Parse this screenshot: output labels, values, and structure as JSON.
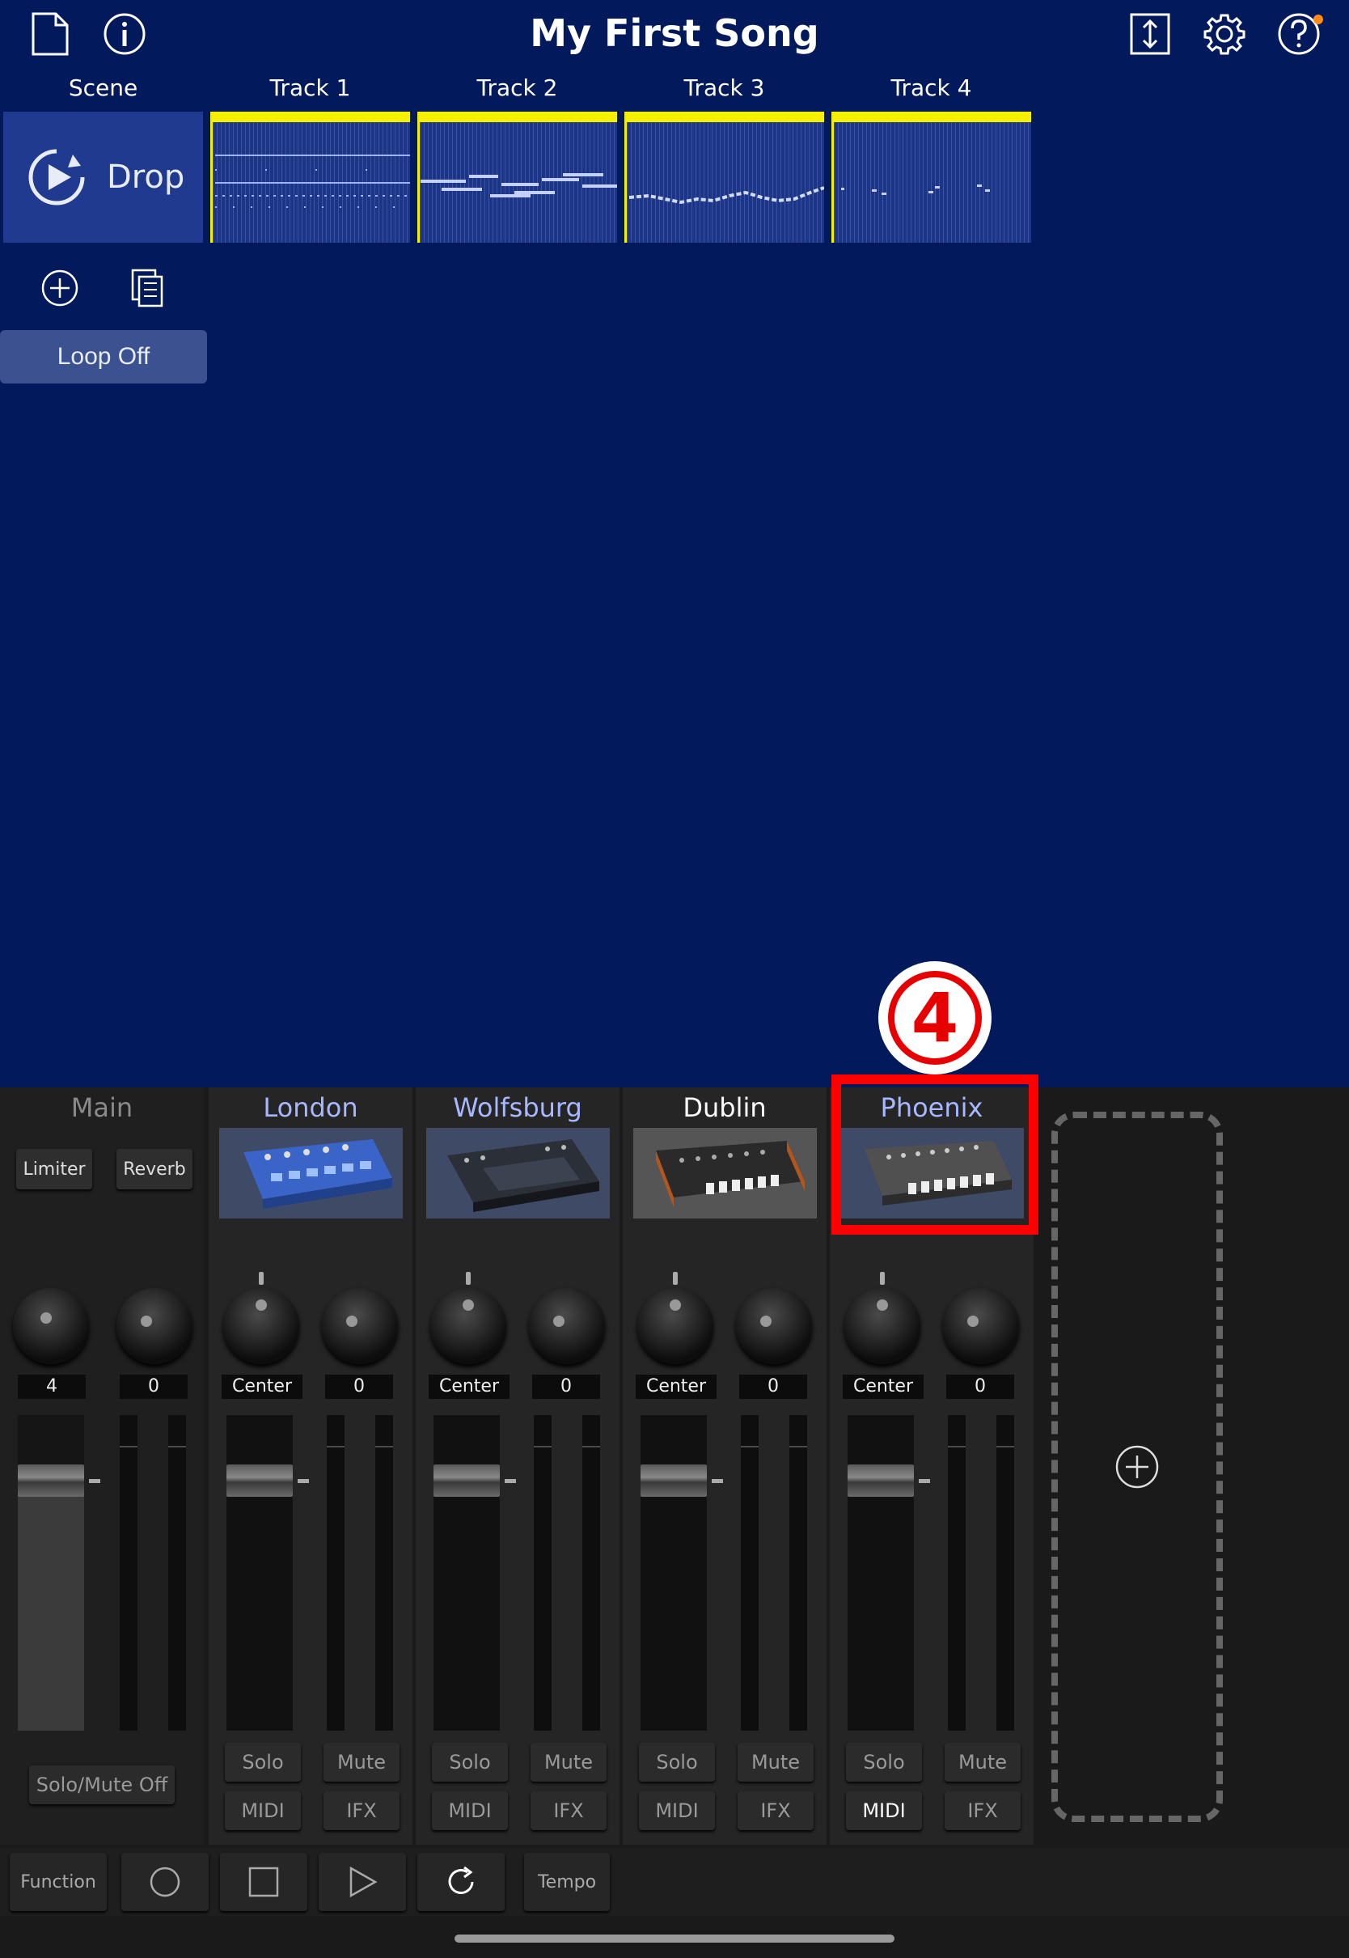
{
  "app": {
    "song_title": "My First Song"
  },
  "toolbar": {
    "icons": [
      "new-document-icon",
      "info-icon",
      "import-export-icon",
      "settings-gear-icon",
      "help-icon"
    ]
  },
  "grid": {
    "headers": {
      "scene": "Scene",
      "tracks": [
        "Track 1",
        "Track 2",
        "Track 3",
        "Track 4"
      ]
    },
    "scene": {
      "name": "Drop"
    },
    "loop_button": "Loop Off"
  },
  "mixer": {
    "main": {
      "name": "Main",
      "effects": [
        "Limiter",
        "Reverb"
      ],
      "values": [
        "4",
        "0"
      ],
      "solo_mute": "Solo/Mute Off"
    },
    "strips": [
      {
        "name": "London",
        "pan": "Center",
        "value": "0",
        "solo": "Solo",
        "mute": "Mute",
        "midi": "MIDI",
        "ifx": "IFX"
      },
      {
        "name": "Wolfsburg",
        "pan": "Center",
        "value": "0",
        "solo": "Solo",
        "mute": "Mute",
        "midi": "MIDI",
        "ifx": "IFX"
      },
      {
        "name": "Dublin",
        "pan": "Center",
        "value": "0",
        "solo": "Solo",
        "mute": "Mute",
        "midi": "MIDI",
        "ifx": "IFX"
      },
      {
        "name": "Phoenix",
        "pan": "Center",
        "value": "0",
        "solo": "Solo",
        "mute": "Mute",
        "midi": "MIDI",
        "ifx": "IFX"
      }
    ]
  },
  "transport": {
    "function": "Function",
    "tempo": "Tempo"
  },
  "annotation": {
    "number": "4"
  },
  "colors": {
    "background": "#021a5c",
    "clip_marker": "#f4f000",
    "highlight": "#ff0000"
  }
}
